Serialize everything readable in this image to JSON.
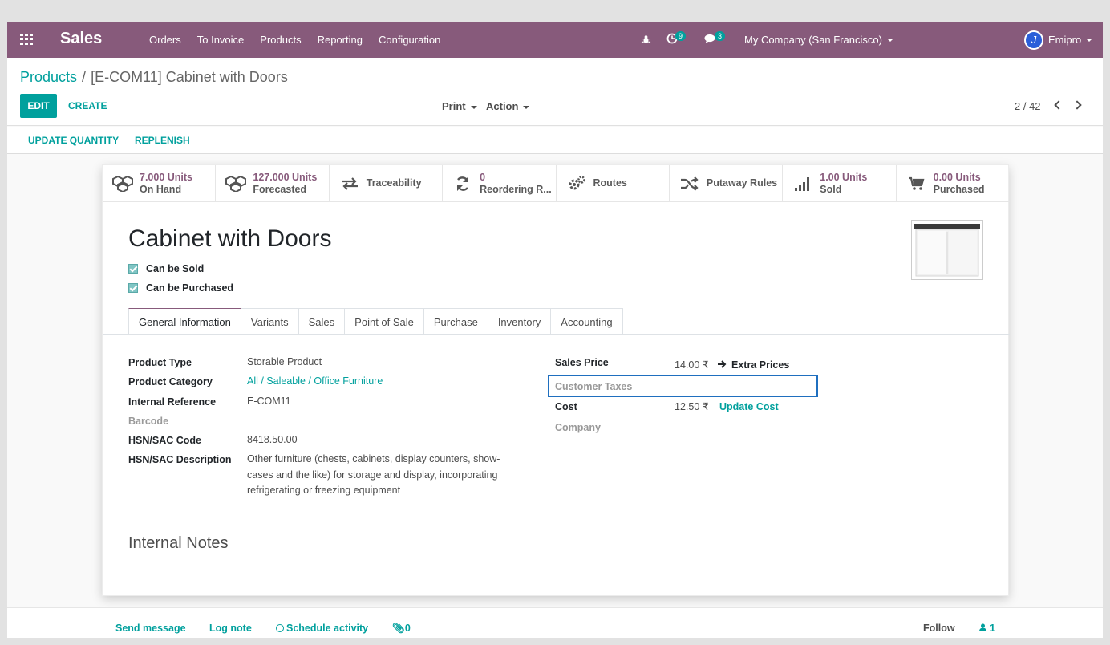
{
  "navbar": {
    "brand": "Sales",
    "menu": [
      "Orders",
      "To Invoice",
      "Products",
      "Reporting",
      "Configuration"
    ],
    "activity_count": "9",
    "messages_count": "3",
    "company": "My Company (San Francisco)",
    "user": "Emipro"
  },
  "breadcrumb": {
    "parent": "Products",
    "separator": "/",
    "current": "[E-COM11] Cabinet with Doors"
  },
  "toolbar": {
    "edit": "EDIT",
    "create": "CREATE",
    "print": "Print",
    "action": "Action",
    "pager": "2 / 42"
  },
  "statusbar": {
    "update_quantity": "UPDATE QUANTITY",
    "replenish": "REPLENISH"
  },
  "smart_buttons": [
    {
      "top": "7.000 Units",
      "bottom": "On Hand",
      "icon": "cubes-icon"
    },
    {
      "top": "127.000 Units",
      "bottom": "Forecasted",
      "icon": "cubes-icon"
    },
    {
      "top": "",
      "bottom": "Traceability",
      "icon": "exchange-icon"
    },
    {
      "top": "0",
      "bottom": "Reordering R...",
      "icon": "refresh-icon"
    },
    {
      "top": "",
      "bottom": "Routes",
      "icon": "cogs-icon"
    },
    {
      "top": "",
      "bottom": "Putaway Rules",
      "icon": "random-icon"
    },
    {
      "top": "1.00 Units",
      "bottom": "Sold",
      "icon": "signal-icon"
    },
    {
      "top": "0.00 Units",
      "bottom": "Purchased",
      "icon": "cart-icon"
    }
  ],
  "product": {
    "name": "Cabinet with Doors",
    "can_be_sold": "Can be Sold",
    "can_be_purchased": "Can be Purchased"
  },
  "tabs": [
    "General Information",
    "Variants",
    "Sales",
    "Point of Sale",
    "Purchase",
    "Inventory",
    "Accounting"
  ],
  "general": {
    "product_type_label": "Product Type",
    "product_type": "Storable Product",
    "category_label": "Product Category",
    "category": "All / Saleable / Office Furniture",
    "internal_ref_label": "Internal Reference",
    "internal_ref": "E-COM11",
    "barcode_label": "Barcode",
    "hsn_code_label": "HSN/SAC Code",
    "hsn_code": "8418.50.00",
    "hsn_desc_label": "HSN/SAC Description",
    "hsn_desc_line1": "Other furniture (chests, cabinets, display counters, show-",
    "hsn_desc_line2": "cases and the like) for storage and display, incorporating",
    "hsn_desc_line3": "refrigerating or freezing equipment",
    "sales_price_label": "Sales Price",
    "sales_price": "14.00 ₹",
    "extra_prices": "Extra Prices",
    "customer_taxes_label": "Customer Taxes",
    "cost_label": "Cost",
    "cost": "12.50 ₹",
    "update_cost": "Update Cost",
    "company_label": "Company",
    "internal_notes": "Internal Notes"
  },
  "chatter": {
    "send_message": "Send message",
    "log_note": "Log note",
    "schedule_activity": "Schedule activity",
    "attachments": "0",
    "follow": "Follow",
    "followers": "1"
  },
  "colors": {
    "navbar": "#875a7b",
    "accent": "#00a09d",
    "highlight_box": "#1f6fbf"
  }
}
